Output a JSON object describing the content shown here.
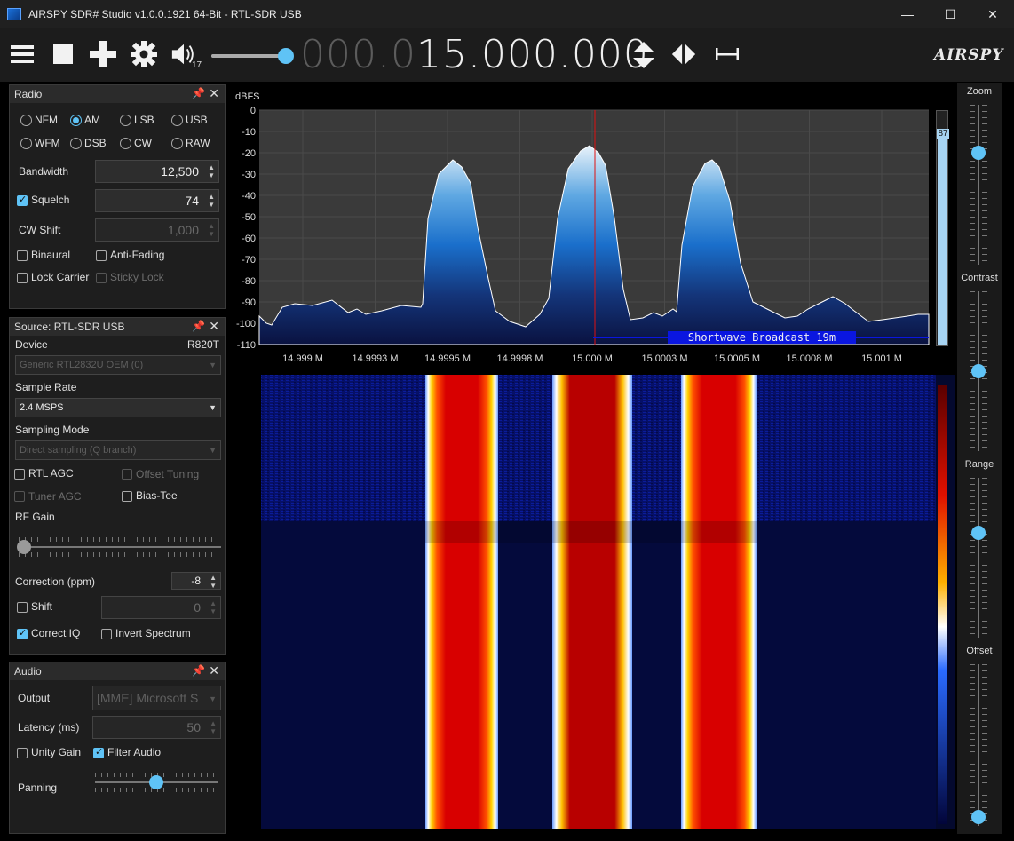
{
  "window": {
    "title": "AIRSPY SDR# Studio v1.0.0.1921 64-Bit - RTL-SDR USB"
  },
  "toolbar": {
    "volume": "17",
    "volume_level": 0.95,
    "freq_dim": "000.0",
    "freq_lit": "15.000.000",
    "logo": "AIRSPY"
  },
  "radio": {
    "title": "Radio",
    "modes": [
      "NFM",
      "AM",
      "LSB",
      "USB",
      "WFM",
      "DSB",
      "CW",
      "RAW"
    ],
    "selected_mode": "AM",
    "bandwidth_label": "Bandwidth",
    "bandwidth": "12,500",
    "squelch_label": "Squelch",
    "squelch": "74",
    "cwshift_label": "CW Shift",
    "cwshift": "1,000",
    "binaural": "Binaural",
    "anti_fading": "Anti-Fading",
    "lock_carrier": "Lock Carrier",
    "sticky_lock": "Sticky Lock"
  },
  "source": {
    "title": "Source: RTL-SDR USB",
    "device_label": "Device",
    "tuner": "R820T",
    "device": "Generic RTL2832U OEM (0)",
    "sample_rate_label": "Sample Rate",
    "sample_rate": "2.4 MSPS",
    "sampling_mode_label": "Sampling Mode",
    "sampling_mode": "Direct sampling (Q branch)",
    "rtl_agc": "RTL AGC",
    "offset_tuning": "Offset Tuning",
    "tuner_agc": "Tuner AGC",
    "bias_tee": "Bias-Tee",
    "rf_gain_label": "RF Gain",
    "correction_label": "Correction (ppm)",
    "correction": "-8",
    "shift": "Shift",
    "shift_value": "0",
    "correct_iq": "Correct IQ",
    "invert_spectrum": "Invert Spectrum"
  },
  "audio": {
    "title": "Audio",
    "output_label": "Output",
    "output": "[MME] Microsoft S",
    "latency_label": "Latency (ms)",
    "latency": "50",
    "unity_gain": "Unity Gain",
    "filter_audio": "Filter Audio",
    "panning_label": "Panning",
    "panning_level": 0.5
  },
  "spectrum": {
    "unit": "dBFS",
    "y_ticks": [
      "0",
      "-10",
      "-20",
      "-30",
      "-40",
      "-50",
      "-60",
      "-70",
      "-80",
      "-90",
      "-100",
      "-110"
    ],
    "x_ticks": [
      "14.999 M",
      "14.9993 M",
      "14.9995 M",
      "14.9998 M",
      "15.000 M",
      "15.0003 M",
      "15.0005 M",
      "15.0008 M",
      "15.001 M"
    ],
    "band_label": "Shortwave Broadcast 19m",
    "meter_value": "87"
  },
  "sliders": {
    "zoom": "Zoom",
    "contrast": "Contrast",
    "range": "Range",
    "offset": "Offset"
  },
  "colors": {
    "accent": "#5fc3f6",
    "spectrum_grid": "#4a4a4a",
    "band_bar": "#0a16e0"
  }
}
